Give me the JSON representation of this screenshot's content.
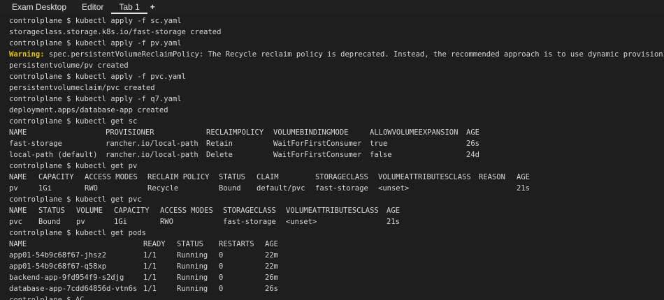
{
  "tabs": {
    "exam_desktop": "Exam Desktop",
    "editor": "Editor",
    "tab1": "Tab 1",
    "add": "+"
  },
  "colors": {
    "background": "#1e1e1e",
    "text": "#d6d6d6",
    "warning": "#e5c100"
  },
  "terminal": {
    "cmd_sc_yaml": "controlplane $ kubectl apply -f sc.yaml",
    "out_sc_created": "storageclass.storage.k8s.io/fast-storage created",
    "cmd_pv_yaml": "controlplane $ kubectl apply -f pv.yaml",
    "warning_label": "Warning:",
    "warning_text": " spec.persistentVolumeReclaimPolicy: The Recycle reclaim policy is deprecated. Instead, the recommended approach is to use dynamic provisioning.",
    "out_pv_created": "persistentvolume/pv created",
    "cmd_pvc_yaml": "controlplane $ kubectl apply -f pvc.yaml",
    "out_pvc_created": "persistentvolumeclaim/pvc created",
    "cmd_q7_yaml": "controlplane $ kubectl apply -f q7.yaml",
    "out_deploy_created": "deployment.apps/database-app created",
    "cmd_get_sc": "controlplane $ kubectl get sc",
    "cmd_get_pv": "controlplane $ kubectl get pv",
    "cmd_get_pvc": "controlplane $ kubectl get pvc",
    "cmd_get_pods": "controlplane $ kubectl get pods",
    "last_prompt_partial": "controlplane $ AC"
  },
  "sc_table": {
    "headers": [
      "NAME",
      "PROVISIONER",
      "RECLAIMPOLICY",
      "VOLUMEBINDINGMODE",
      "ALLOWVOLUMEEXPANSION",
      "AGE"
    ],
    "rows": [
      [
        "fast-storage",
        "rancher.io/local-path",
        "Retain",
        "WaitForFirstConsumer",
        "true",
        "26s"
      ],
      [
        "local-path (default)",
        "rancher.io/local-path",
        "Delete",
        "WaitForFirstConsumer",
        "false",
        "24d"
      ]
    ]
  },
  "pv_table": {
    "headers": [
      "NAME",
      "CAPACITY",
      "ACCESS MODES",
      "RECLAIM POLICY",
      "STATUS",
      "CLAIM",
      "STORAGECLASS",
      "VOLUMEATTRIBUTESCLASS",
      "REASON",
      "AGE"
    ],
    "rows": [
      [
        "pv",
        "1Gi",
        "RWO",
        "Recycle",
        "Bound",
        "default/pvc",
        "fast-storage",
        "<unset>",
        "",
        "21s"
      ]
    ]
  },
  "pvc_table": {
    "headers": [
      "NAME",
      "STATUS",
      "VOLUME",
      "CAPACITY",
      "ACCESS MODES",
      "STORAGECLASS",
      "VOLUMEATTRIBUTESCLASS",
      "AGE"
    ],
    "rows": [
      [
        "pvc",
        "Bound",
        "pv",
        "1Gi",
        "RWO",
        "fast-storage",
        "<unset>",
        "21s"
      ]
    ]
  },
  "pods_table": {
    "headers": [
      "NAME",
      "READY",
      "STATUS",
      "RESTARTS",
      "AGE"
    ],
    "rows": [
      [
        "app01-54b9c68f67-jhsz2",
        "1/1",
        "Running",
        "0",
        "22m"
      ],
      [
        "app01-54b9c68f67-q58xp",
        "1/1",
        "Running",
        "0",
        "22m"
      ],
      [
        "backend-app-9fd954f9-s2djg",
        "1/1",
        "Running",
        "0",
        "26m"
      ],
      [
        "database-app-7cdd64856d-vtn6s",
        "1/1",
        "Running",
        "0",
        "26s"
      ]
    ]
  }
}
